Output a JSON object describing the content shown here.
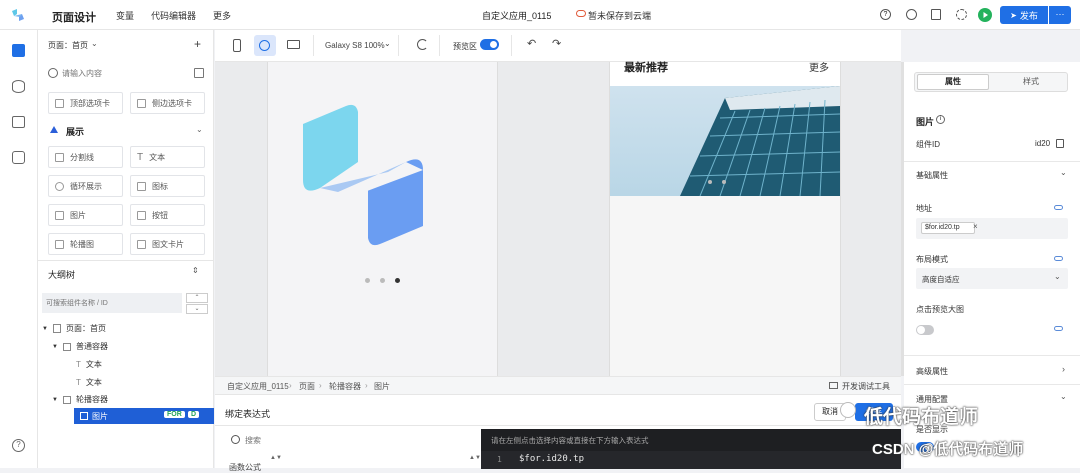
{
  "header": {
    "title": "页面设计",
    "menu": [
      "变量",
      "代码编辑器",
      "更多"
    ],
    "app_name": "自定义应用_0115",
    "save_status": "暂未保存到云端",
    "publish": "发布",
    "more": "···"
  },
  "left": {
    "page_label": "页面：首页",
    "search_placeholder": "请输入内容",
    "components_top": [
      "顶部选项卡",
      "侧边选项卡"
    ],
    "section": "展示",
    "components": [
      "分割线",
      "文本",
      "循环展示",
      "图标",
      "图片",
      "按钮",
      "轮播图",
      "图文卡片"
    ],
    "outline_title": "大纲树",
    "outline_search_placeholder": "可搜索组件名称 / ID",
    "tree": [
      "页面：首页",
      "普通容器",
      "文本",
      "文本",
      "轮播容器",
      "图片"
    ],
    "tag_for": "FOR",
    "tag_d": "D"
  },
  "toolbar": {
    "device": "Galaxy S8 100%",
    "preview": "预览区"
  },
  "canvas": {
    "recommend_title": "最新推荐",
    "recommend_more": "更多"
  },
  "bottom": {
    "breadcrumb": [
      "自定义应用_0115",
      "页面",
      "轮播容器",
      "图片"
    ],
    "devtools": "开发调试工具",
    "bind_title": "绑定表达式",
    "search_placeholder": "搜索",
    "cancel": "取消",
    "save": "保存",
    "row_label": "函数公式",
    "editor_hint": "请在左侧点击选择内容或直接在下方输入表达式",
    "line_no": "1",
    "code": "$for.id20.tp"
  },
  "right": {
    "tabs": [
      "属性",
      "样式"
    ],
    "component": "图片",
    "id_label": "组件ID",
    "id_value": "id20",
    "basic": "基础属性",
    "address": "地址",
    "address_tag": "$for.id20.tp",
    "layout": "布局模式",
    "layout_value": "高度自适应",
    "preview_big": "点击预览大图",
    "advanced": "高级属性",
    "general": "通用配置",
    "display": "是否显示"
  },
  "watermark": {
    "line1": "低代码布道师",
    "line2": "CSDN @低代码布道师"
  }
}
